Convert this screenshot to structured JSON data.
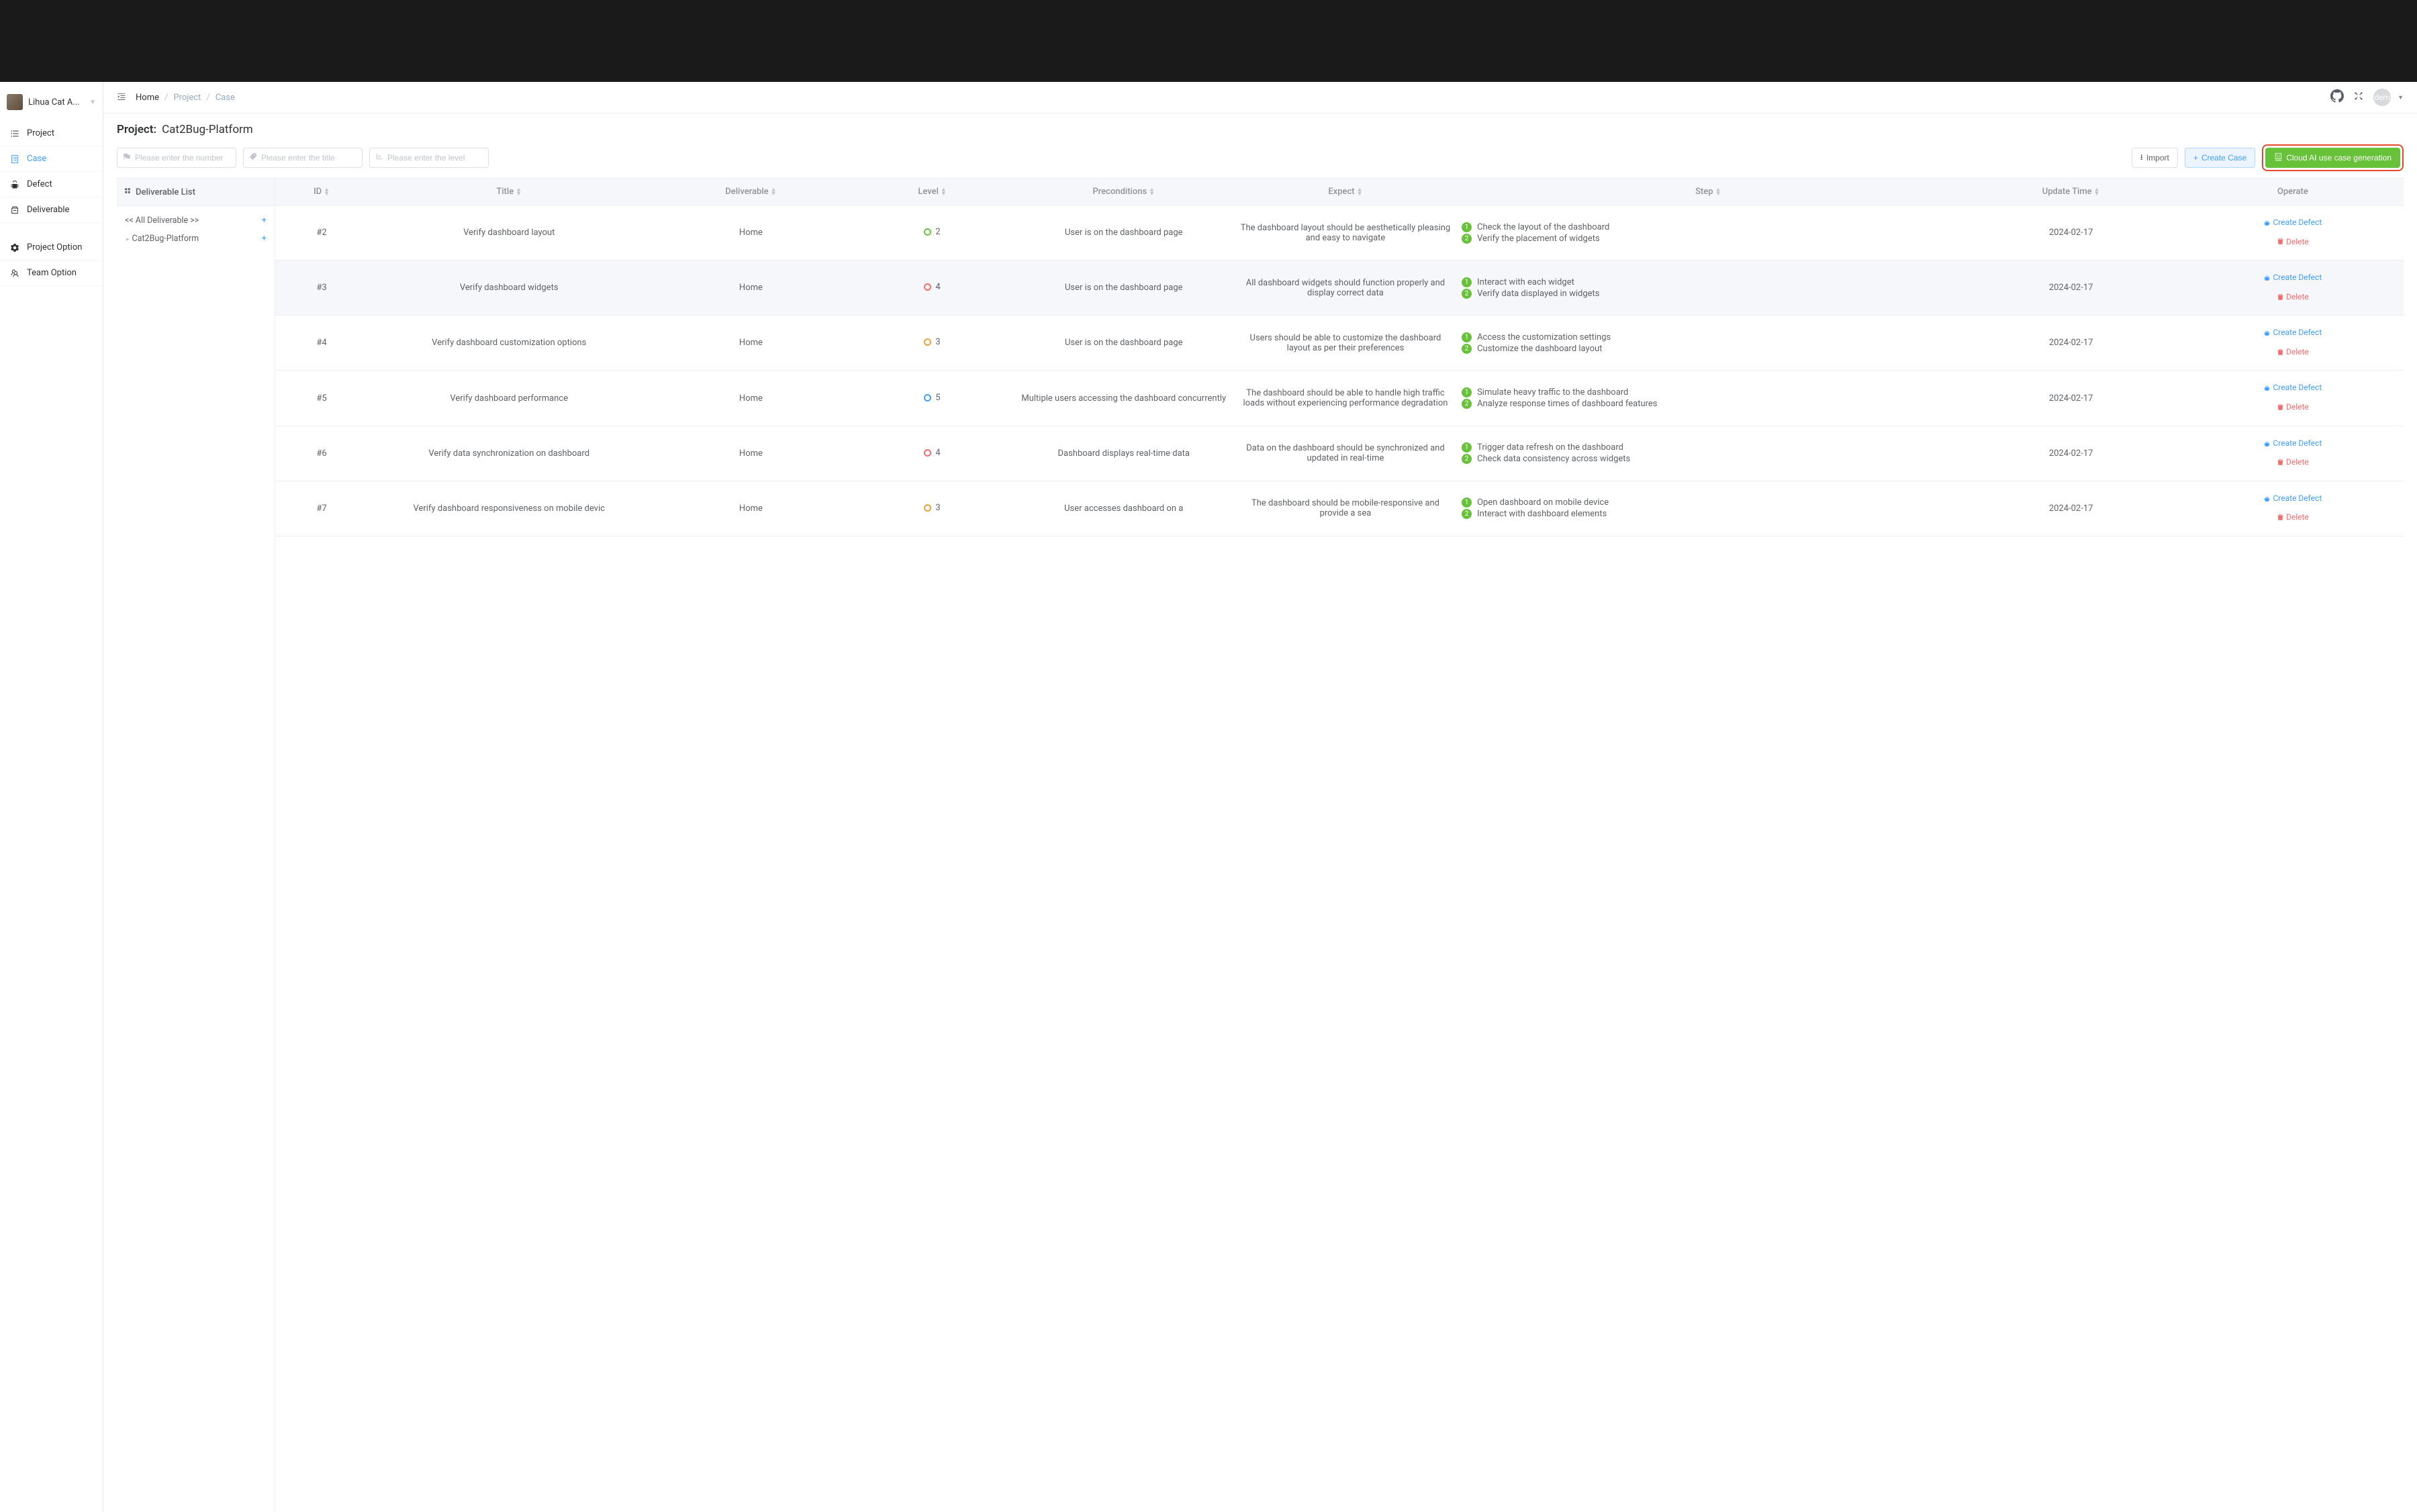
{
  "header": {
    "project_switcher": "Lihua Cat A...",
    "breadcrumb": [
      "Home",
      "Project",
      "Case"
    ],
    "avatar_text": "dem"
  },
  "nav": [
    {
      "label": "Project",
      "name": "project"
    },
    {
      "label": "Case",
      "name": "case",
      "active": true
    },
    {
      "label": "Defect",
      "name": "defect"
    },
    {
      "label": "Deliverable",
      "name": "deliverable"
    },
    {
      "label": "Project Option",
      "name": "project-option"
    },
    {
      "label": "Team Option",
      "name": "team-option"
    }
  ],
  "project": {
    "label": "Project:",
    "name": "Cat2Bug-Platform"
  },
  "filters": {
    "number_placeholder": "Please enter the number",
    "title_placeholder": "Please enter the title",
    "level_placeholder": "Please enter the level"
  },
  "buttons": {
    "import": "Import",
    "create_case": "Create Case",
    "cloud_ai": "Cloud AI use case generation"
  },
  "deliverable_panel": {
    "title": "Deliverable List",
    "all": "<< All Deliverable >>",
    "root": "Cat2Bug-Platform"
  },
  "table": {
    "columns": {
      "id": "ID",
      "title": "Title",
      "deliverable": "Deliverable",
      "level": "Level",
      "preconditions": "Preconditions",
      "expect": "Expect",
      "step": "Step",
      "update_time": "Update Time",
      "operate": "Operate"
    },
    "op_labels": {
      "create_defect": "Create Defect",
      "delete": "Delete"
    },
    "rows": [
      {
        "id": "#2",
        "title": "Verify dashboard layout",
        "deliverable": "Home",
        "level": 2,
        "level_color": "green",
        "preconditions": "User is on the dashboard page",
        "expect": "The dashboard layout should be aesthetically pleasing and easy to navigate",
        "steps": [
          "Check the layout of the dashboard",
          "Verify the placement of widgets"
        ],
        "update_time": "2024-02-17"
      },
      {
        "id": "#3",
        "title": "Verify dashboard widgets",
        "deliverable": "Home",
        "level": 4,
        "level_color": "red",
        "preconditions": "User is on the dashboard page",
        "expect": "All dashboard widgets should function properly and display correct data",
        "steps": [
          "Interact with each widget",
          "Verify data displayed in widgets"
        ],
        "update_time": "2024-02-17",
        "hover": true
      },
      {
        "id": "#4",
        "title": "Verify dashboard customization options",
        "deliverable": "Home",
        "level": 3,
        "level_color": "orange",
        "preconditions": "User is on the dashboard page",
        "expect": "Users should be able to customize the dashboard layout as per their preferences",
        "steps": [
          "Access the customization settings",
          "Customize the dashboard layout"
        ],
        "update_time": "2024-02-17"
      },
      {
        "id": "#5",
        "title": "Verify dashboard performance",
        "deliverable": "Home",
        "level": 5,
        "level_color": "blue",
        "preconditions": "Multiple users accessing the dashboard concurrently",
        "expect": "The dashboard should be able to handle high traffic loads without experiencing performance degradation",
        "steps": [
          "Simulate heavy traffic to the dashboard",
          "Analyze response times of dashboard features"
        ],
        "update_time": "2024-02-17"
      },
      {
        "id": "#6",
        "title": "Verify data synchronization on dashboard",
        "deliverable": "Home",
        "level": 4,
        "level_color": "red",
        "preconditions": "Dashboard displays real-time data",
        "expect": "Data on the dashboard should be synchronized and updated in real-time",
        "steps": [
          "Trigger data refresh on the dashboard",
          "Check data consistency across widgets"
        ],
        "update_time": "2024-02-17"
      },
      {
        "id": "#7",
        "title": "Verify dashboard responsiveness on mobile devic",
        "deliverable": "Home",
        "level": 3,
        "level_color": "orange",
        "preconditions": "User accesses dashboard on a",
        "expect": "The dashboard should be mobile-responsive and provide a sea",
        "steps": [
          "Open dashboard on mobile device",
          "Interact with dashboard elements"
        ],
        "update_time": "2024-02-17"
      }
    ]
  }
}
